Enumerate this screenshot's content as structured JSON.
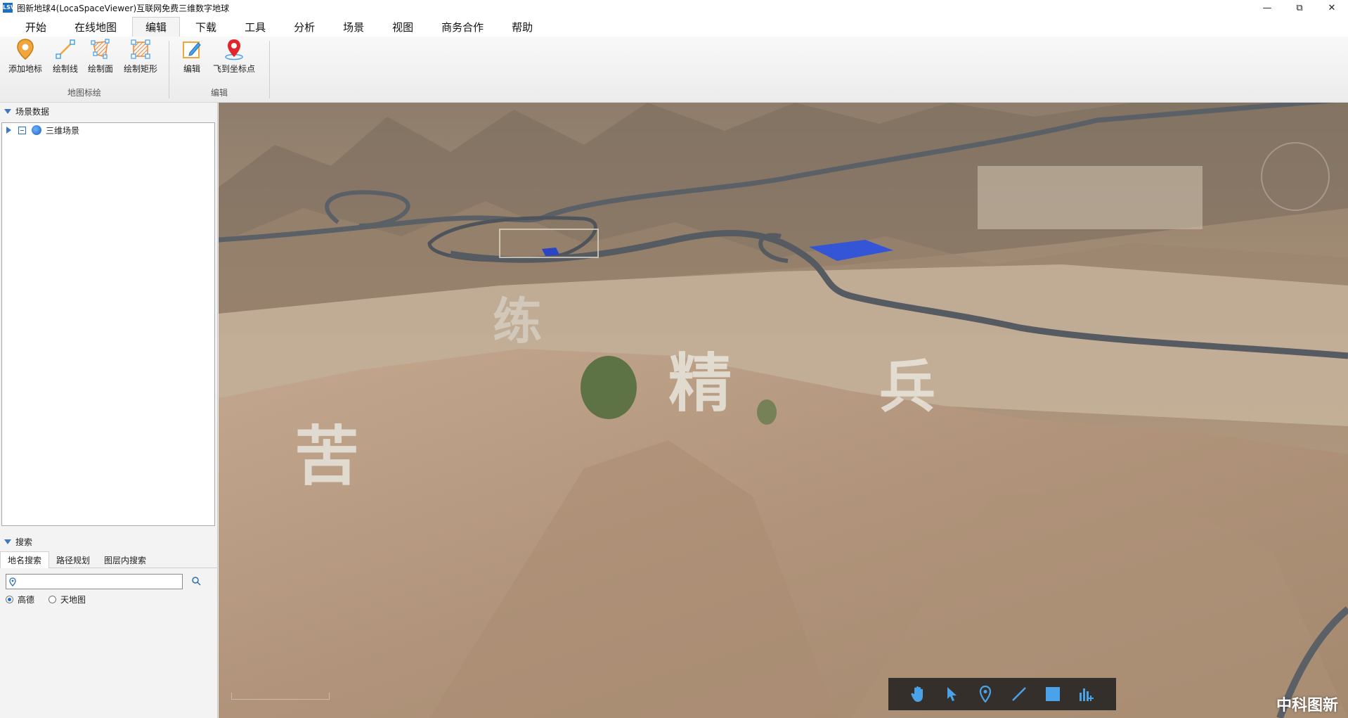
{
  "window": {
    "title": "图新地球4(LocaSpaceViewer)互联网免费三维数字地球",
    "app_icon_text": "LSV",
    "controls": {
      "minimize": "—",
      "restore": "⧉",
      "close": "✕"
    }
  },
  "menu": {
    "tabs": [
      {
        "label": "开始"
      },
      {
        "label": "在线地图"
      },
      {
        "label": "编辑"
      },
      {
        "label": "下载"
      },
      {
        "label": "工具"
      },
      {
        "label": "分析"
      },
      {
        "label": "场景"
      },
      {
        "label": "视图"
      },
      {
        "label": "商务合作"
      },
      {
        "label": "帮助"
      }
    ],
    "active_tab": "编辑"
  },
  "ribbon": {
    "group1": {
      "label": "地图标绘",
      "buttons": [
        {
          "label": "添加地标",
          "icon": "placemark-icon"
        },
        {
          "label": "绘制线",
          "icon": "draw-line-icon"
        },
        {
          "label": "绘制面",
          "icon": "draw-polygon-icon"
        },
        {
          "label": "绘制矩形",
          "icon": "draw-rectangle-icon"
        }
      ]
    },
    "group2": {
      "label": "编辑",
      "buttons": [
        {
          "label": "编辑",
          "icon": "edit-pencil-icon"
        },
        {
          "label": "飞到坐标点",
          "icon": "fly-to-point-icon"
        }
      ]
    }
  },
  "scene_panel": {
    "header": "场景数据",
    "tree": [
      {
        "label": "三维场景",
        "icon": "globe-icon",
        "expanded": false,
        "checked": "partial"
      }
    ]
  },
  "search_panel": {
    "header": "搜索",
    "tabs": [
      {
        "label": "地名搜索"
      },
      {
        "label": "路径规划"
      },
      {
        "label": "图层内搜索"
      }
    ],
    "active_tab": "地名搜索",
    "input": {
      "value": "",
      "placeholder": ""
    },
    "sources": [
      {
        "label": "高德",
        "selected": true
      },
      {
        "label": "天地图",
        "selected": false
      }
    ]
  },
  "map": {
    "hill_characters": [
      "苦",
      "练",
      "精",
      "兵"
    ],
    "watermark": "中科图新",
    "toolbar": [
      {
        "icon": "pan-hand-icon"
      },
      {
        "icon": "select-arrow-icon"
      },
      {
        "icon": "placemark-icon"
      },
      {
        "icon": "measure-line-icon"
      },
      {
        "icon": "area-square-icon"
      },
      {
        "icon": "chart-add-icon"
      }
    ]
  },
  "colors": {
    "accent": "#2b6fb6",
    "terrain": "#b69a80",
    "road": "#5b5f66",
    "toolbar_bg": "#1e1e1e",
    "icon_blue": "#4aa3e8"
  }
}
